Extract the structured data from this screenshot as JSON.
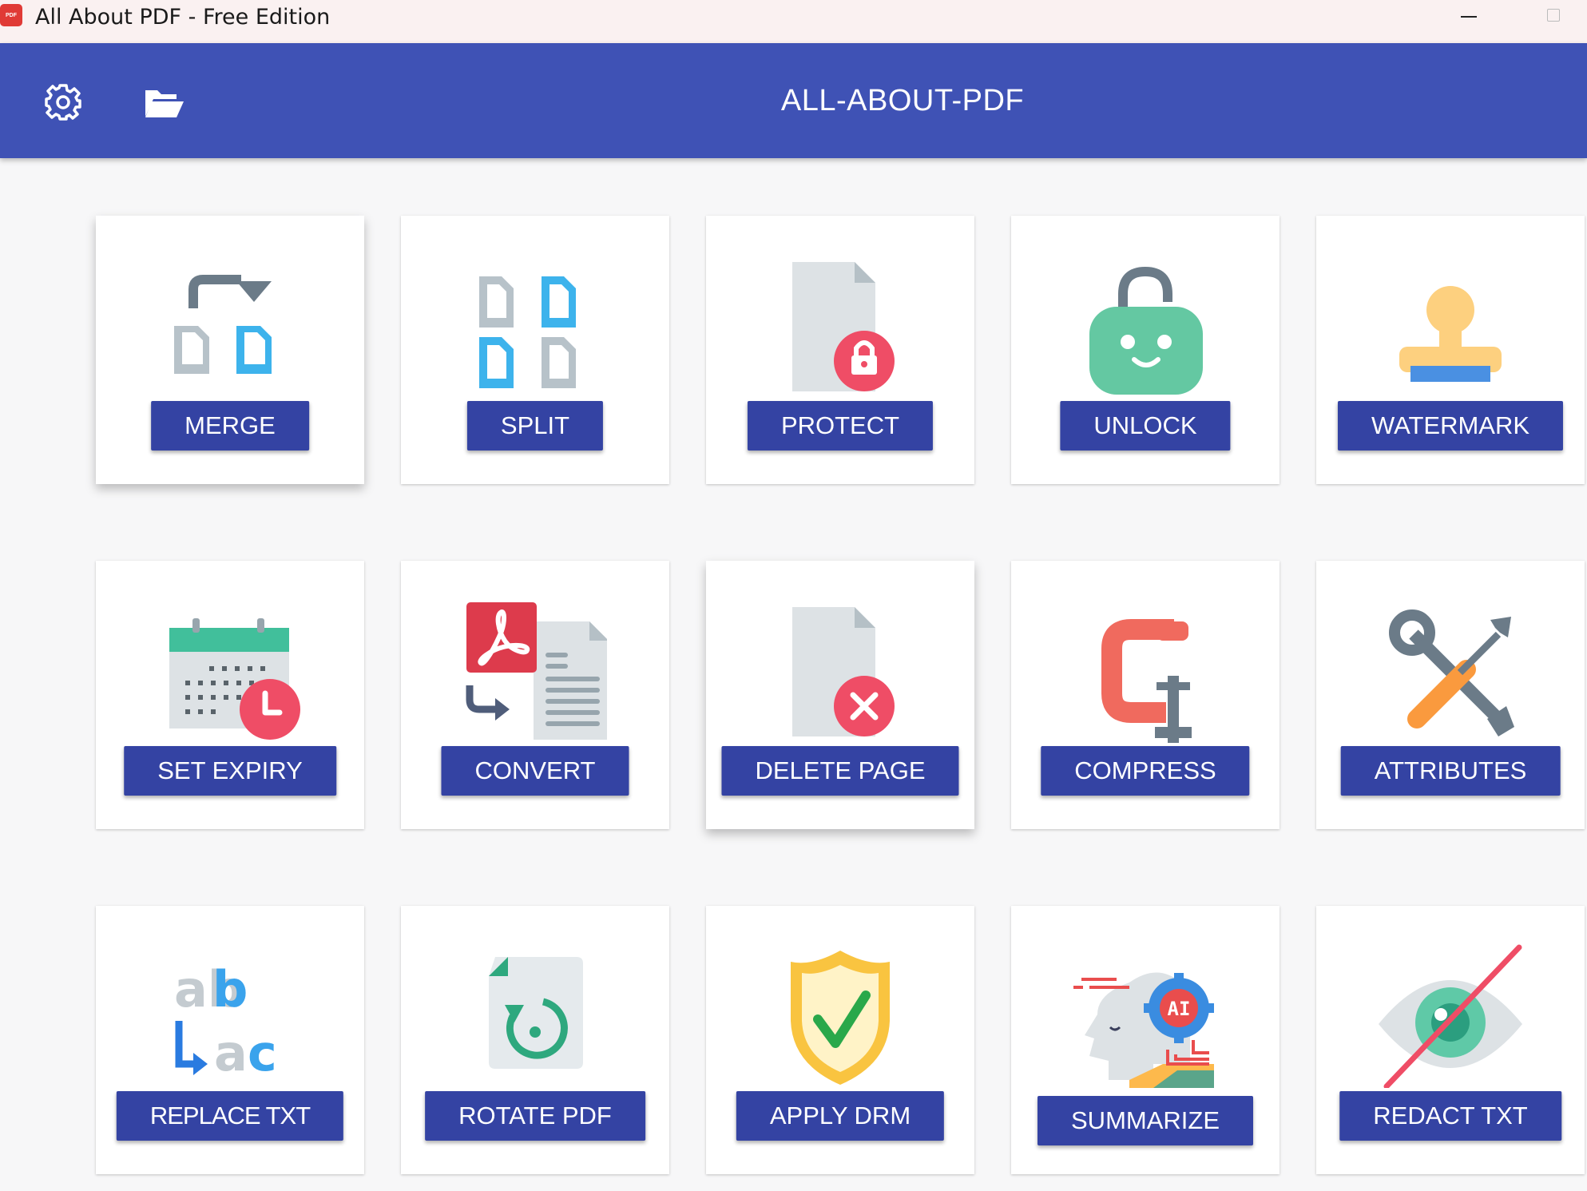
{
  "window": {
    "app_icon_text": "PDF",
    "title": "All About PDF - Free Edition"
  },
  "header": {
    "title": "ALL-ABOUT-PDF",
    "settings_icon": "gear-icon",
    "open_icon": "folder-open-icon"
  },
  "tools": [
    {
      "label": "MERGE",
      "icon": "merge-icon"
    },
    {
      "label": "SPLIT",
      "icon": "split-icon"
    },
    {
      "label": "PROTECT",
      "icon": "protect-icon"
    },
    {
      "label": "UNLOCK",
      "icon": "unlock-icon"
    },
    {
      "label": "WATERMARK",
      "icon": "stamp-icon"
    },
    {
      "label": "SET EXPIRY",
      "icon": "calendar-clock-icon"
    },
    {
      "label": "CONVERT",
      "icon": "convert-icon"
    },
    {
      "label": "DELETE PAGE",
      "icon": "delete-page-icon"
    },
    {
      "label": "COMPRESS",
      "icon": "clamp-icon"
    },
    {
      "label": "ATTRIBUTES",
      "icon": "tools-icon"
    },
    {
      "label": "REPLACE TXT",
      "icon": "replace-text-icon",
      "icon_text_1": "ab",
      "icon_text_2": "ac"
    },
    {
      "label": "ROTATE PDF",
      "icon": "rotate-icon"
    },
    {
      "label": "APPLY DRM",
      "icon": "shield-check-icon"
    },
    {
      "label": "SUMMARIZE",
      "icon": "ai-head-icon",
      "icon_text": "AI"
    },
    {
      "label": "REDACT TXT",
      "icon": "eye-crossed-icon"
    }
  ],
  "colors": {
    "appbar": "#3f52b5",
    "button": "#3443a3",
    "background": "#f7f7f8"
  }
}
